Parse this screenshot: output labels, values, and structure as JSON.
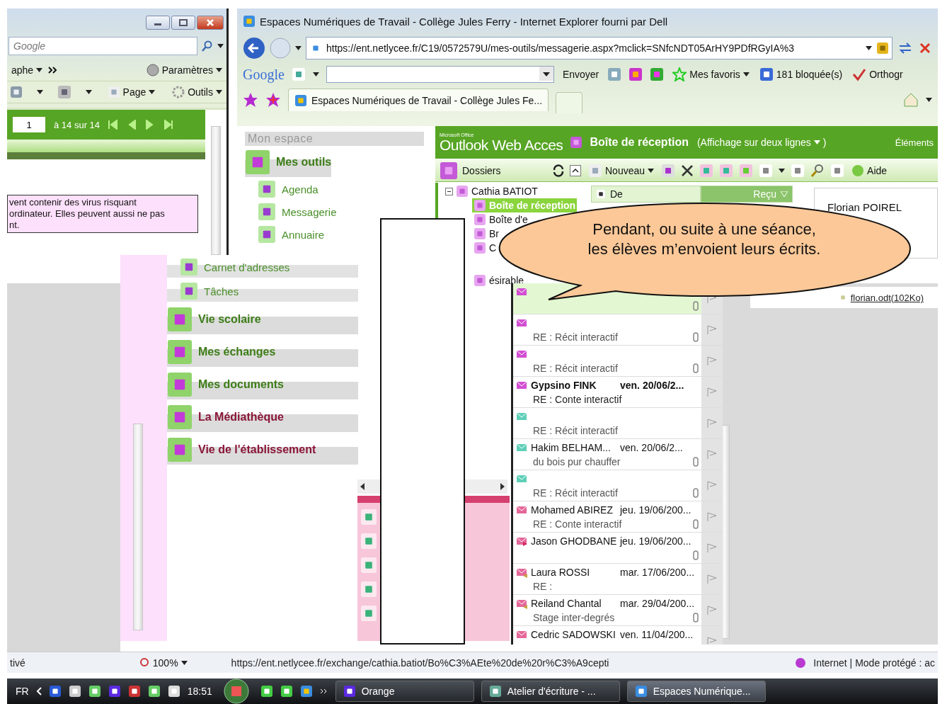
{
  "left_window": {
    "search": {
      "placeholder": "Google"
    },
    "links_bar": {
      "item": "aphe",
      "settings": "Paramètres"
    },
    "command_bar": [
      "Page",
      "Outils"
    ],
    "pager": {
      "page": "1",
      "range": "à 14 sur 14"
    },
    "warning": [
      "vent contenir des virus risquant",
      "ordinateur. Elles peuvent aussi ne pas",
      "nt."
    ]
  },
  "ie_window": {
    "title": "Espaces Numériques de Travail - Collège Jules Ferry - Internet Explorer fourni par Dell",
    "address": "https://ent.netlycee.fr/C19/0572579U/mes-outils/messagerie.aspx?mclick=SNfcNDT05ArHY9PDfRGyIA%3",
    "google_bar": {
      "logo": "Google",
      "send": "Envoyer",
      "favorites": "Mes favoris",
      "blocked": "181 bloquée(s)",
      "spelling": "Orthogr"
    },
    "tabs": [
      {
        "label": "Espaces Numériques de Travail - Collège Jules Fe...",
        "selected": true
      }
    ]
  },
  "nav": {
    "header": "Mon espace",
    "items": [
      {
        "label": "Mes outils",
        "kind": "section",
        "color": "#3d7d17"
      },
      {
        "label": "Agenda",
        "kind": "link",
        "color": "#4a8f2a"
      },
      {
        "label": "Messagerie",
        "kind": "link",
        "color": "#4a8f2a"
      },
      {
        "label": "Annuaire",
        "kind": "link",
        "color": "#4a8f2a"
      }
    ]
  },
  "nav_continued": {
    "items": [
      {
        "label": "Carnet d'adresses",
        "kind": "link",
        "color": "#4a8f2a"
      },
      {
        "label": "Tâches",
        "kind": "link",
        "color": "#4a8f2a"
      },
      {
        "label": "Vie scolaire",
        "kind": "section",
        "color": "#3d7d17"
      },
      {
        "label": "Mes échanges",
        "kind": "section",
        "color": "#3d7d17"
      },
      {
        "label": "Mes documents",
        "kind": "section",
        "color": "#3d7d17"
      },
      {
        "label": "La Médiathèque",
        "kind": "section",
        "color": "#8a1538"
      },
      {
        "label": "Vie de l'établissement",
        "kind": "section",
        "color": "#8a1538"
      }
    ]
  },
  "owa": {
    "brand_small": "Microsoft Office",
    "brand": "Outlook Web Acces",
    "folder_title": "Boîte de réception",
    "view": "(Affichage sur deux lignes",
    "view_end": ")",
    "items_label": "Éléments",
    "folders_label": "Dossiers",
    "new_label": "Nouveau",
    "help_label": "Aide",
    "tree": [
      {
        "label": "Cathia BATIOT",
        "expanded": true,
        "children": [
          {
            "label": "Boîte de réception",
            "selected": true
          },
          {
            "label": "Boîte d'e",
            "selected": false
          },
          {
            "label": "Br",
            "selected": false
          },
          {
            "label": "C",
            "selected": false
          },
          {
            "label": "ésirable",
            "selected": false
          }
        ]
      }
    ],
    "columns": [
      {
        "label": "De",
        "sorted": false
      },
      {
        "label": "Reçu",
        "sorted": true
      }
    ],
    "messages": [
      {
        "kind": "unread",
        "unread": false,
        "selected": true,
        "attachment": true
      },
      {
        "kind": "unread",
        "unread": false,
        "selected": false,
        "attachment": true,
        "subject": "RE : Récit interactif"
      },
      {
        "kind": "unread",
        "unread": false,
        "selected": false,
        "attachment": true,
        "subject": "RE : Récit interactif"
      },
      {
        "kind": "unread",
        "sender": "Gypsino FINK",
        "date": "ven. 20/06/2...",
        "subject": "RE : Conte interactif",
        "unread": true,
        "selected": false,
        "attachment": false
      },
      {
        "kind": "read",
        "unread": false,
        "selected": false,
        "attachment": false,
        "subject": "RE : Récit interactif"
      },
      {
        "kind": "read",
        "sender": "Hakim BELHAM...",
        "date": "ven. 20/06/2...",
        "subject": "du bois pur chauffer",
        "unread": false,
        "selected": false,
        "attachment": true
      },
      {
        "kind": "read",
        "unread": false,
        "selected": false,
        "attachment": true,
        "subject": "RE : Récit interactif"
      },
      {
        "kind": "opened",
        "sender": "Mohamed ABIREZ",
        "date": "jeu. 19/06/200...",
        "subject": "RE : Conte interactif",
        "unread": false,
        "selected": false,
        "attachment": true
      },
      {
        "kind": "forwarded",
        "sender": "Jason GHODBANE",
        "date": "jeu. 19/06/200...",
        "unread": false,
        "selected": false,
        "attachment": true
      },
      {
        "kind": "replied",
        "sender": "Laura ROSSI",
        "date": "mar. 17/06/200...",
        "subject": "RE :",
        "unread": false,
        "selected": false,
        "attachment": false
      },
      {
        "kind": "replied",
        "sender": "Reiland Chantal",
        "date": "mar. 29/04/200...",
        "subject": "Stage inter-degrés",
        "unread": false,
        "selected": false,
        "attachment": true
      },
      {
        "kind": "opened",
        "sender": "Cedric SADOWSKI",
        "date": "ven. 11/04/200...",
        "unread": false,
        "selected": false,
        "attachment": false
      }
    ],
    "reading": {
      "from": "Florian POIREL",
      "attachment": "florian.odt(102Ko)"
    }
  },
  "callout": "Pendant, ou suite à une séance,\nles élèves m’envoient leurs écrits.",
  "status_bar": {
    "left": "tivé",
    "zoom": "100%",
    "url": "https://ent.netlycee.fr/exchange/cathia.batiot/Bo%C3%AEte%20de%20r%C3%A9cepti",
    "zone": "Internet | Mode protégé : ac"
  },
  "taskbar": {
    "language": "FR",
    "time": "18:51",
    "buttons": [
      {
        "label": "Orange",
        "selected": false
      },
      {
        "label": "Atelier d'écriture - ...",
        "selected": false
      },
      {
        "label": "Espaces Numérique...",
        "selected": true
      }
    ]
  }
}
